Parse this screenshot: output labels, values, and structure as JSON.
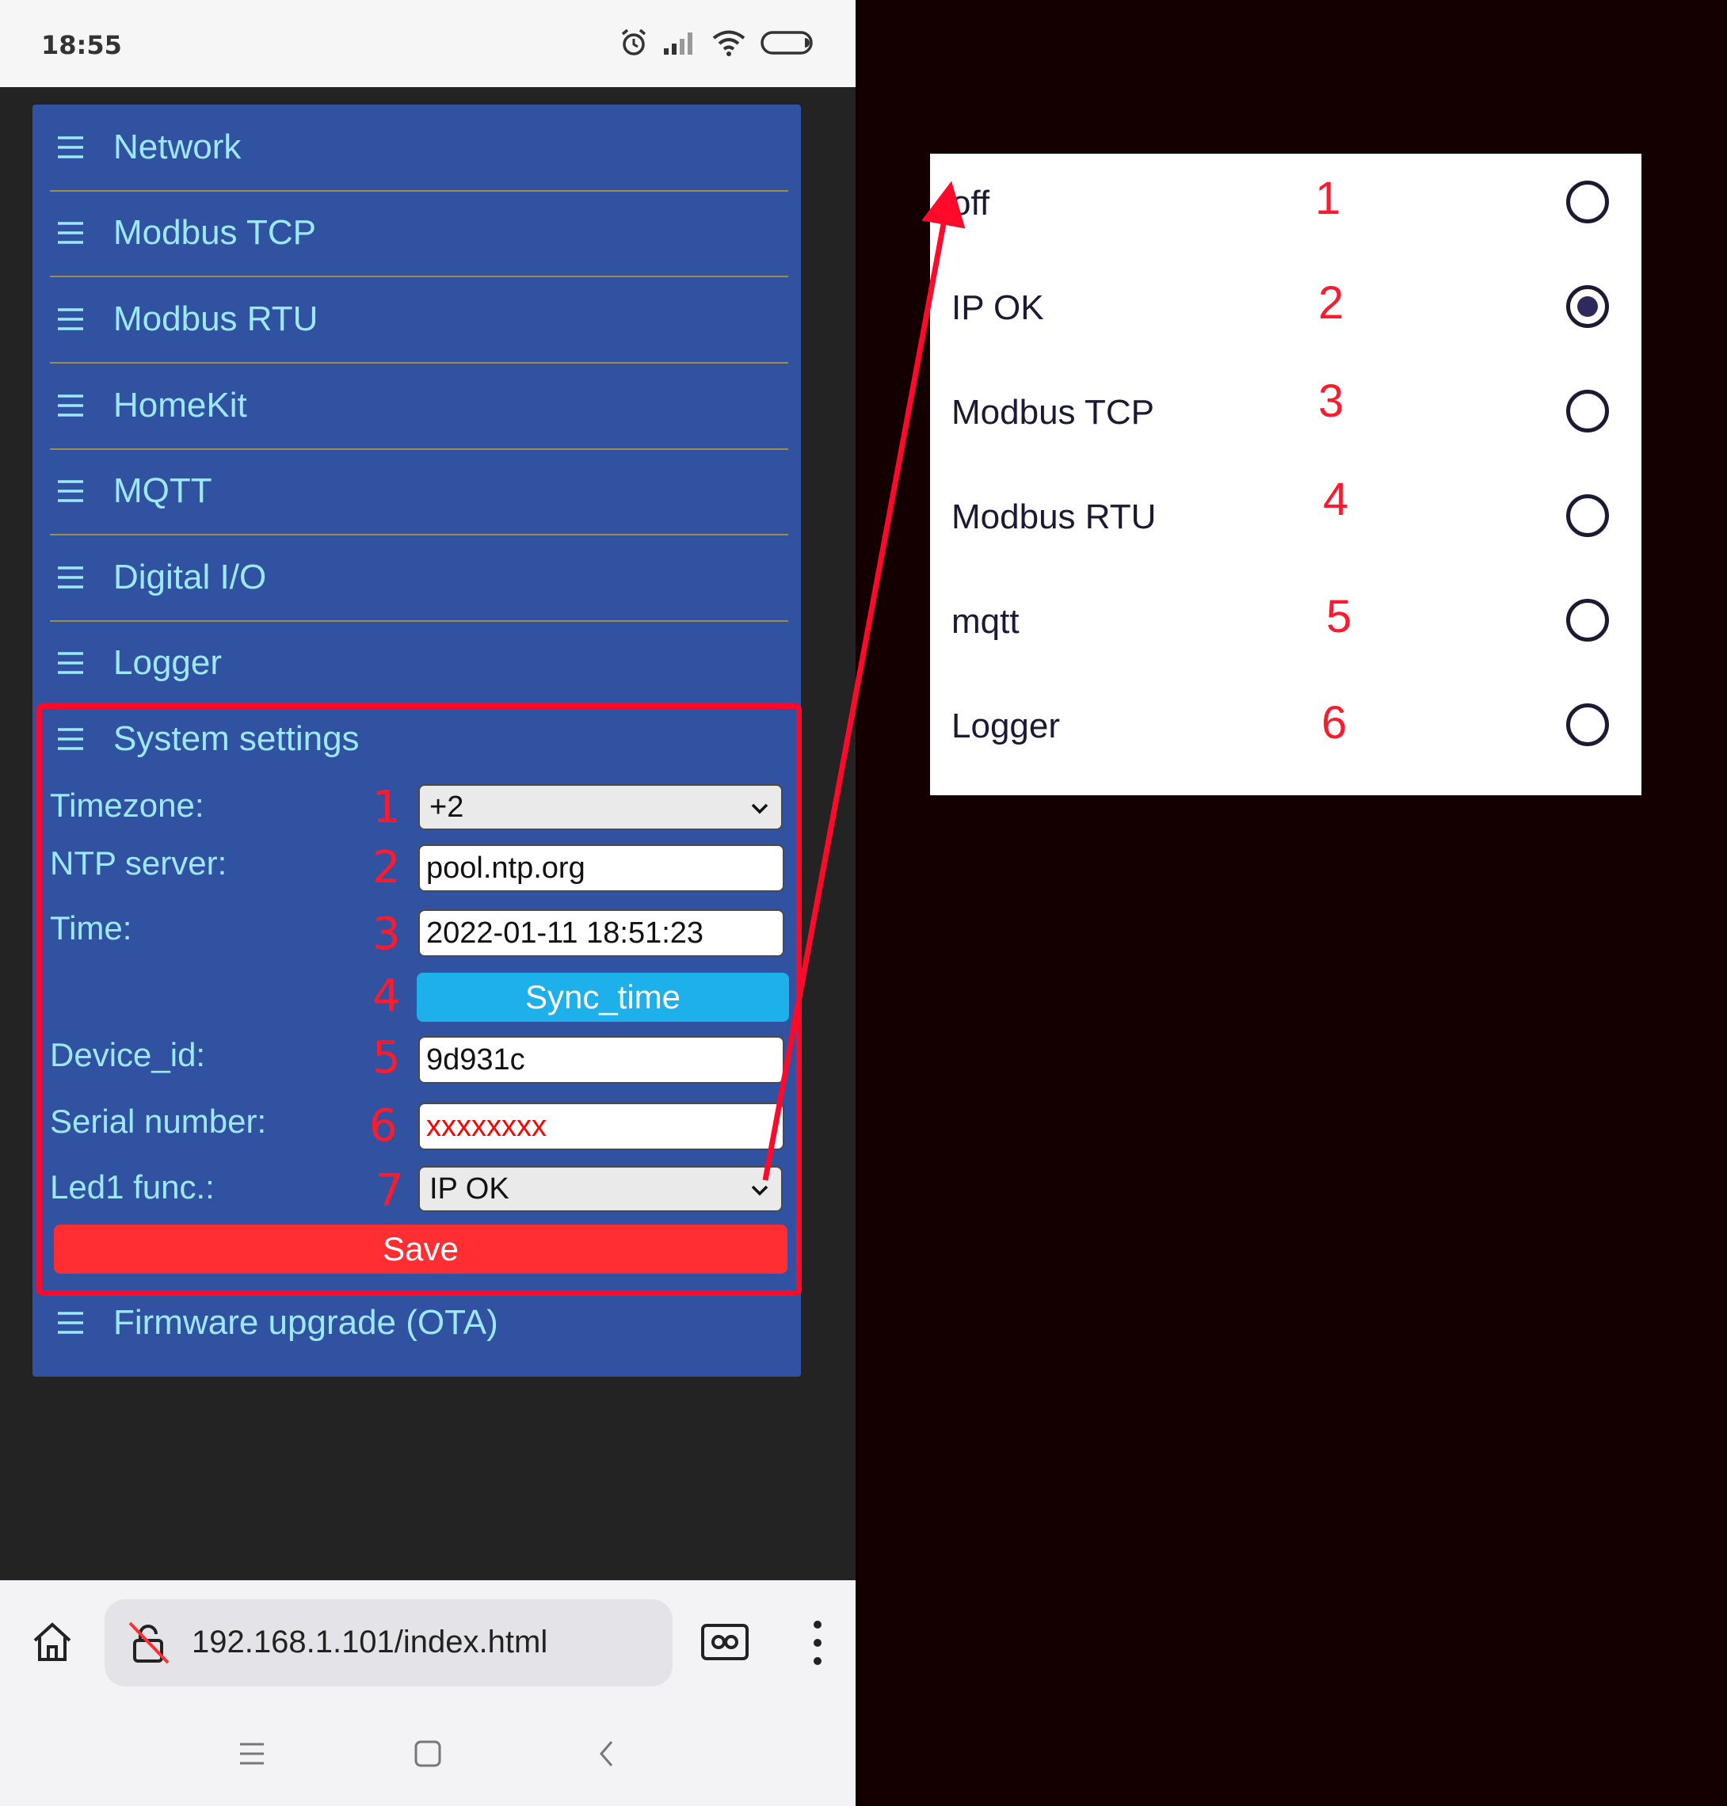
{
  "status_bar": {
    "time": "18:55"
  },
  "menu": {
    "items": [
      {
        "label": "Network"
      },
      {
        "label": "Modbus TCP"
      },
      {
        "label": "Modbus RTU"
      },
      {
        "label": "HomeKit"
      },
      {
        "label": "MQTT"
      },
      {
        "label": "Digital I/O"
      },
      {
        "label": "Logger"
      }
    ],
    "system_settings": {
      "title": "System settings",
      "timezone": {
        "label": "Timezone:",
        "value": "+2",
        "num": "1"
      },
      "ntp": {
        "label": "NTP server:",
        "value": "pool.ntp.org",
        "num": "2"
      },
      "time": {
        "label": "Time:",
        "value": "2022-01-11 18:51:23",
        "num": "3"
      },
      "sync": {
        "label": "Sync_time",
        "num": "4"
      },
      "device_id": {
        "label": "Device_id:",
        "value": "9d931c",
        "num": "5"
      },
      "serial": {
        "label": "Serial number:",
        "value": "xxxxxxxx",
        "num": "6",
        "value_color": "#ff0000"
      },
      "led1": {
        "label": "Led1 func.:",
        "value": "IP OK",
        "num": "7"
      },
      "save_label": "Save"
    },
    "firmware": {
      "label": "Firmware upgrade (OTA)"
    }
  },
  "browser": {
    "url": "192.168.1.101/index.html"
  },
  "led_dialog": {
    "options": [
      {
        "label": "off",
        "num": "1",
        "selected": false
      },
      {
        "label": "IP OK",
        "num": "2",
        "selected": true
      },
      {
        "label": "Modbus TCP",
        "num": "3",
        "selected": false
      },
      {
        "label": "Modbus RTU",
        "num": "4",
        "selected": false
      },
      {
        "label": "mqtt",
        "num": "5",
        "selected": false
      },
      {
        "label": "Logger",
        "num": "6",
        "selected": false
      }
    ]
  },
  "colors": {
    "panel": "#3152a0",
    "menu_text": "#9be8ff",
    "annotation_red": "#ff1a2e",
    "sync_button": "#1eb0ea",
    "save_button": "#ff2e33"
  }
}
